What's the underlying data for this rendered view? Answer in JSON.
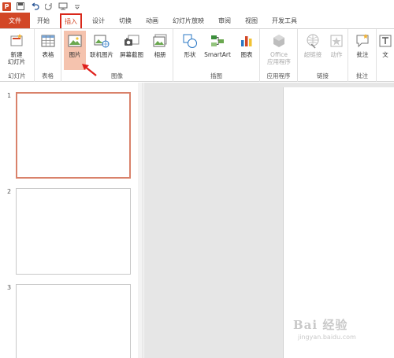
{
  "qat": {
    "logo": "P",
    "icons": [
      "save-icon",
      "undo-icon",
      "redo-icon",
      "start-from-beginning-icon",
      "customize-icon"
    ]
  },
  "tabs": [
    {
      "label": "文件"
    },
    {
      "label": "开始"
    },
    {
      "label": "插入"
    },
    {
      "label": "设计"
    },
    {
      "label": "切换"
    },
    {
      "label": "动画"
    },
    {
      "label": "幻灯片放映"
    },
    {
      "label": "审阅"
    },
    {
      "label": "视图"
    },
    {
      "label": "开发工具"
    }
  ],
  "ribbon": {
    "groups": [
      {
        "label": "幻灯片"
      },
      {
        "label": "表格"
      },
      {
        "label": "图像"
      },
      {
        "label": "插图"
      },
      {
        "label": "应用程序"
      },
      {
        "label": "链接"
      },
      {
        "label": "批注"
      }
    ],
    "buttons": {
      "new_slide": "新建\n幻灯片",
      "table": "表格",
      "picture": "图片",
      "online_picture": "联机图片",
      "screenshot": "屏幕截图",
      "album": "相册",
      "shapes": "形状",
      "smartart": "SmartArt",
      "chart": "图表",
      "office_apps": "Office\n应用程序",
      "hyperlink": "超链接",
      "action": "动作",
      "comment": "批注",
      "textbox": "文"
    }
  },
  "slides": [
    {
      "number": "1"
    },
    {
      "number": "2"
    },
    {
      "number": "3"
    }
  ],
  "watermark": {
    "top": "Bai 经验",
    "bottom": "jingyan.baidu.com"
  },
  "colors": {
    "accent": "#d24726",
    "highlight": "#f5c3ae",
    "tab_outline": "#d9281b",
    "selected_slide_border": "#d9826b"
  }
}
